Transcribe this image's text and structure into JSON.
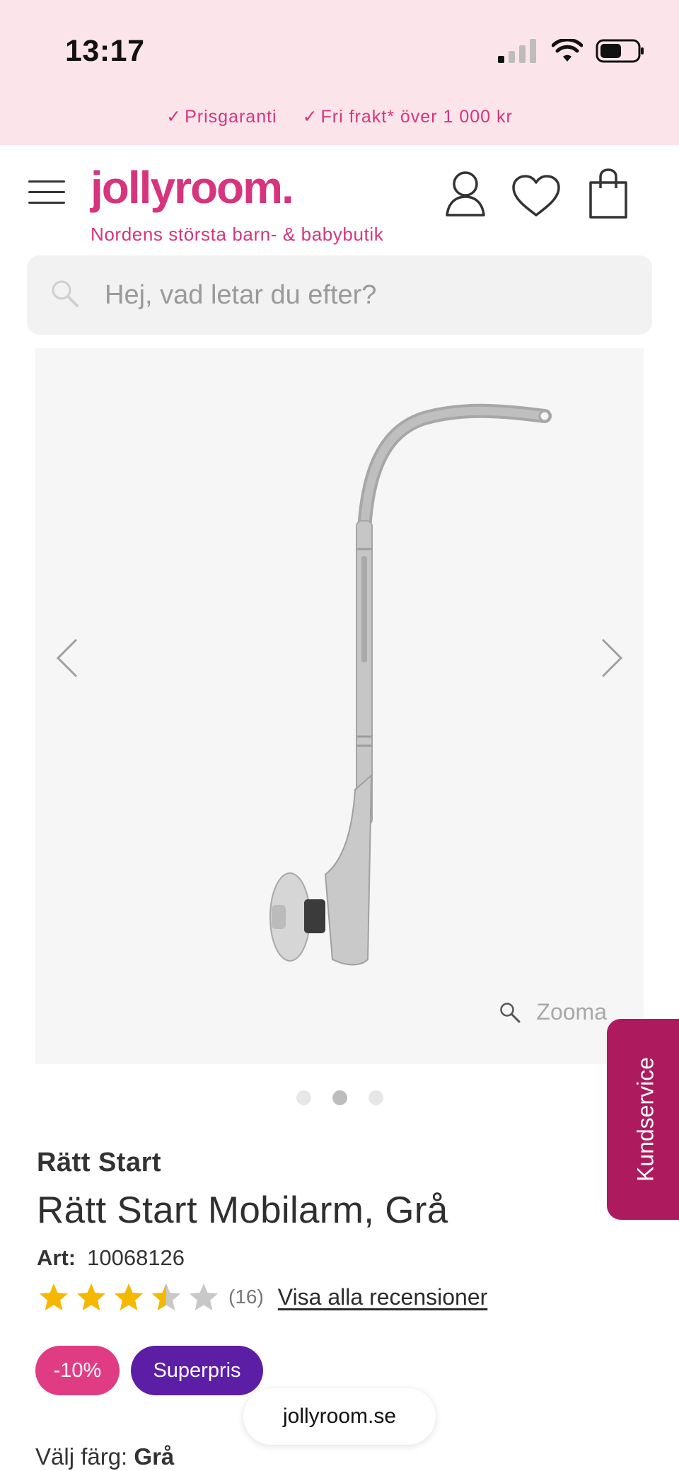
{
  "status_bar": {
    "time": "13:17"
  },
  "promo": {
    "items": [
      "Prisgaranti",
      "Fri frakt* över 1 000 kr"
    ],
    "tick": "✓"
  },
  "header": {
    "logo": "jollyroom.",
    "tagline": "Nordens största barn- & babybutik"
  },
  "search": {
    "placeholder": "Hej, vad letar du efter?"
  },
  "gallery": {
    "zoom_label": "Zooma",
    "slide_count": 3,
    "active_slide": 2
  },
  "side_tab": {
    "label": "Kundservice"
  },
  "product": {
    "brand": "Rätt Start",
    "title": "Rätt Start Mobilarm, Grå",
    "art_label": "Art:",
    "art_number": "10068126",
    "rating": 3.5,
    "rating_count": "(16)",
    "reviews_link": "Visa alla recensioner",
    "badges": {
      "discount": "-10%",
      "superpris": "Superpris"
    },
    "color_label": "Välj färg:",
    "color_value": "Grå"
  },
  "browser": {
    "url": "jollyroom.se"
  },
  "colors": {
    "brand_pink": "#d6357e",
    "promo_bg": "#fce5ea",
    "kundservice_bg": "#ad1a5e",
    "discount_badge": "#e03c84",
    "superpris_badge": "#5b1ea4",
    "star_filled": "#f5b800",
    "star_empty": "#c8c8c8"
  }
}
